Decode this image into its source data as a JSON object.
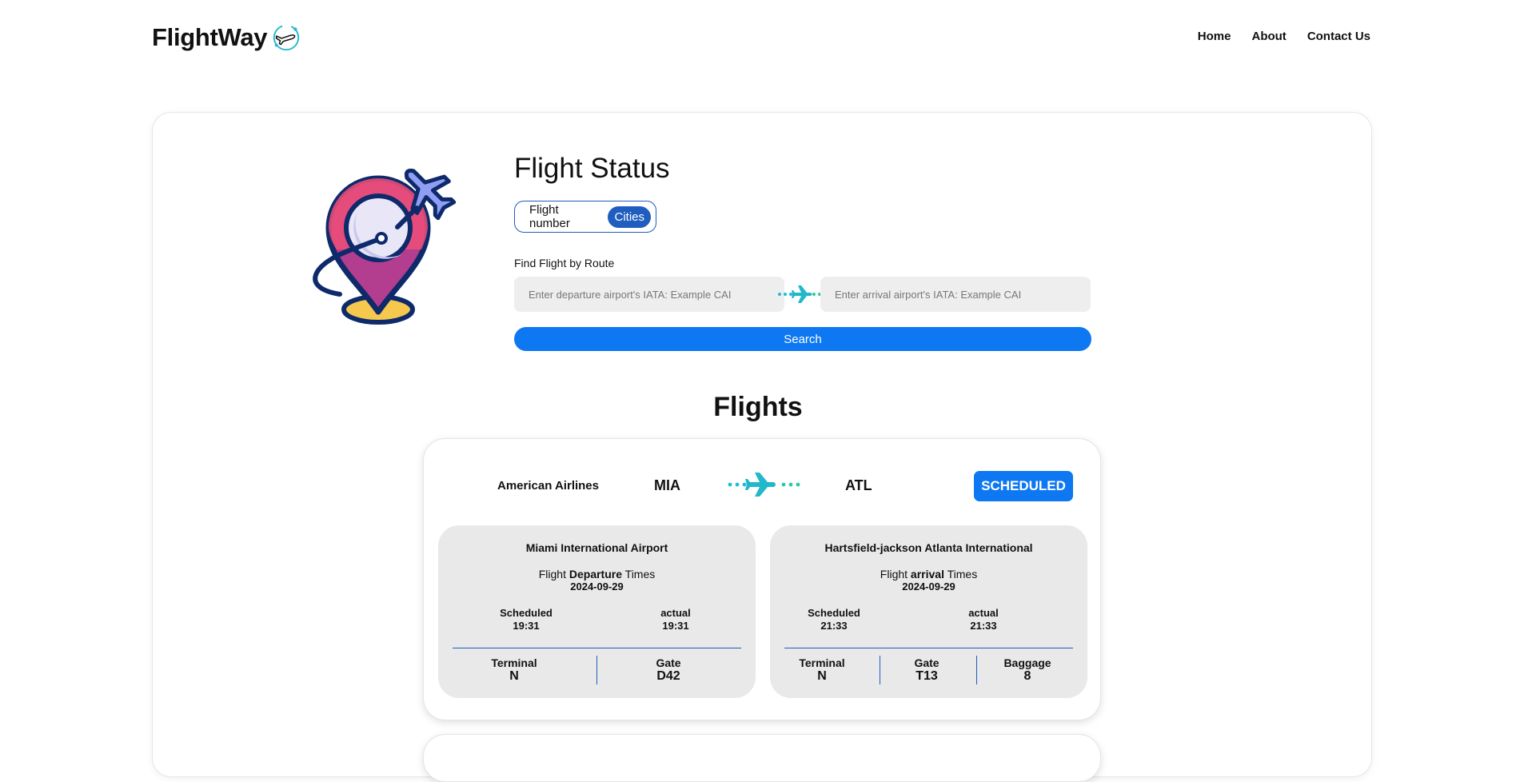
{
  "brand": {
    "name": "FlightWay",
    "icon": "plane-circle-logo-icon"
  },
  "nav": {
    "items": [
      "Home",
      "About",
      "Contact Us"
    ]
  },
  "search": {
    "title": "Flight Status",
    "toggle": {
      "option_flight_number": "Flight number",
      "option_cities": "Cities",
      "selected": "Cities"
    },
    "route_label": "Find Flight by Route",
    "departure_placeholder": "Enter departure airport's IATA: Example CAI",
    "arrival_placeholder": "Enter arrival airport's IATA: Example CAI",
    "search_button": "Search"
  },
  "flights_heading": "Flights",
  "flights": [
    {
      "airline": "American Airlines",
      "from_code": "MIA",
      "to_code": "ATL",
      "status": "SCHEDULED",
      "departure": {
        "airport": "Miami International Airport",
        "times_title_pre": "Flight",
        "times_title_bold": "Departure",
        "times_title_post": "Times",
        "date": "2024-09-29",
        "scheduled_label": "Scheduled",
        "scheduled": "19:31",
        "actual_label": "actual",
        "actual": "19:31",
        "terminal_label": "Terminal",
        "terminal": "N",
        "gate_label": "Gate",
        "gate": "D42"
      },
      "arrival": {
        "airport": "Hartsfield-jackson Atlanta International",
        "times_title_pre": "Flight",
        "times_title_bold": "arrival",
        "times_title_post": "Times",
        "date": "2024-09-29",
        "scheduled_label": "Scheduled",
        "scheduled": "21:33",
        "actual_label": "actual",
        "actual": "21:33",
        "terminal_label": "Terminal",
        "terminal": "N",
        "gate_label": "Gate",
        "gate": "T13",
        "baggage_label": "Baggage",
        "baggage": "8"
      }
    }
  ],
  "colors": {
    "accent": "#0d78f2",
    "toggle_active": "#1f5dbf",
    "route_cyan": "#1bbfd6",
    "route_teal": "#28c8a8"
  }
}
